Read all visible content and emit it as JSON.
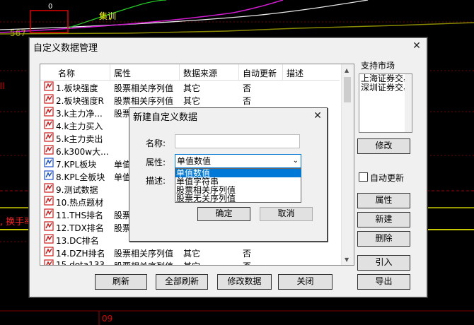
{
  "background": {
    "top_label": "0",
    "tab_label": "集训",
    "left_num": "567",
    "left_mark": "ll",
    "red_text": ", 换手率",
    "bottom_num": "09"
  },
  "main_dialog": {
    "title": "自定义数据管理",
    "close_icon": "close-icon",
    "columns": [
      "名称",
      "属性",
      "数据来源",
      "自动更新",
      "描述"
    ],
    "rows": [
      {
        "name": "1.板块强度",
        "attr": "股票相关序列值",
        "source": "其它",
        "auto": "否",
        "icon": "red-formula-icon"
      },
      {
        "name": "2.板块强度R",
        "attr": "股票相关序列值",
        "source": "其它",
        "auto": "否",
        "icon": "red-formula-icon"
      },
      {
        "name": "3.k主力净...",
        "attr": "股票相关序列值",
        "source": "其它",
        "auto": "否",
        "icon": "red-formula-icon"
      },
      {
        "name": "4.k主力买入",
        "attr": "",
        "source": "",
        "auto": "",
        "icon": "red-formula-icon"
      },
      {
        "name": "5.k主力卖出",
        "attr": "",
        "source": "",
        "auto": "",
        "icon": "red-formula-icon"
      },
      {
        "name": "6.k300w大...",
        "attr": "",
        "source": "",
        "auto": "",
        "icon": "red-formula-icon"
      },
      {
        "name": "7.KPL板块",
        "attr": "单值",
        "source": "",
        "auto": "",
        "icon": "blue-formula-icon"
      },
      {
        "name": "8.KPL全板块",
        "attr": "单值",
        "source": "",
        "auto": "",
        "icon": "blue-formula-icon"
      },
      {
        "name": "9.测试数据",
        "attr": "",
        "source": "",
        "auto": "",
        "icon": "red-formula-icon"
      },
      {
        "name": "10.热点题材",
        "attr": "",
        "source": "",
        "auto": "",
        "icon": "red-formula-icon"
      },
      {
        "name": "11.THS排名",
        "attr": "股票",
        "source": "",
        "auto": "",
        "icon": "red-formula-icon"
      },
      {
        "name": "12.TDX排名",
        "attr": "股票",
        "source": "",
        "auto": "",
        "icon": "red-formula-icon"
      },
      {
        "name": "13.DC排名",
        "attr": "",
        "source": "",
        "auto": "",
        "icon": "red-formula-icon"
      },
      {
        "name": "14.DZH排名",
        "attr": "股票相关序列值",
        "source": "其它",
        "auto": "否",
        "icon": "red-formula-icon"
      },
      {
        "name": "15.dota133",
        "attr": "股票相关序列值",
        "source": "其它",
        "auto": "否",
        "icon": "red-formula-icon"
      }
    ],
    "market": {
      "label": "支持市场",
      "items": [
        "上海证券交易所",
        "深圳证券交易所"
      ],
      "modify": "修改"
    },
    "auto_update_label": "自动更新",
    "side_buttons": {
      "attr": "属性",
      "new": "新建",
      "delete": "删除",
      "import": "引入",
      "export": "导出"
    },
    "bottom_buttons": {
      "refresh": "刷新",
      "refresh_all": "全部刷新",
      "modify_data": "修改数据",
      "close": "关闭"
    }
  },
  "new_dialog": {
    "title": "新建自定义数据",
    "name_label": "名称:",
    "attr_label": "属性:",
    "desc_label": "描述:",
    "name_value": "",
    "attr_value": "单值数值",
    "options": [
      "单值数值",
      "单值字符串",
      "股票相关序列值",
      "股票无关序列值"
    ],
    "ok": "确定",
    "cancel": "取消"
  }
}
